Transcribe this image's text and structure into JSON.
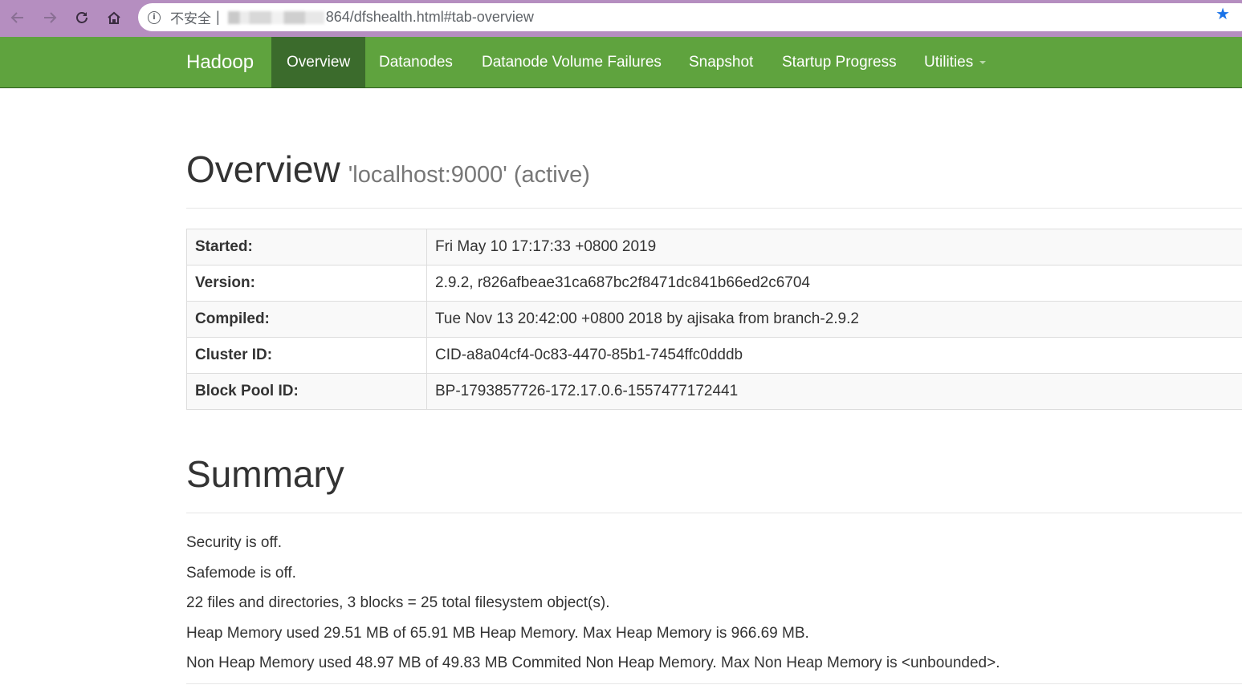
{
  "browser": {
    "insecure_label": "不安全",
    "separator": "|",
    "url_visible": "864/dfshealth.html#tab-overview",
    "icons": [
      "back-icon",
      "forward-icon",
      "reload-icon",
      "home-icon",
      "info-icon",
      "bookmark-star-icon"
    ]
  },
  "navbar": {
    "brand": "Hadoop",
    "items": [
      {
        "label": "Overview",
        "active": true
      },
      {
        "label": "Datanodes"
      },
      {
        "label": "Datanode Volume Failures"
      },
      {
        "label": "Snapshot"
      },
      {
        "label": "Startup Progress"
      },
      {
        "label": "Utilities",
        "dropdown": true
      }
    ],
    "colors": {
      "background": "#5fa33e",
      "active": "#3b6b2c"
    }
  },
  "overview": {
    "title": "Overview",
    "subtitle": "'localhost:9000' (active)",
    "rows": [
      {
        "label": "Started:",
        "value": "Fri May 10 17:17:33 +0800 2019"
      },
      {
        "label": "Version:",
        "value": "2.9.2, r826afbeae31ca687bc2f8471dc841b66ed2c6704"
      },
      {
        "label": "Compiled:",
        "value": "Tue Nov 13 20:42:00 +0800 2018 by ajisaka from branch-2.9.2"
      },
      {
        "label": "Cluster ID:",
        "value": "CID-a8a04cf4-0c83-4470-85b1-7454ffc0dddb"
      },
      {
        "label": "Block Pool ID:",
        "value": "BP-1793857726-172.17.0.6-1557477172441"
      }
    ]
  },
  "summary": {
    "title": "Summary",
    "lines": [
      "Security is off.",
      "Safemode is off.",
      "22 files and directories, 3 blocks = 25 total filesystem object(s).",
      "Heap Memory used 29.51 MB of 65.91 MB Heap Memory. Max Heap Memory is 966.69 MB.",
      "Non Heap Memory used 48.97 MB of 49.83 MB Commited Non Heap Memory. Max Non Heap Memory is <unbounded>."
    ]
  }
}
